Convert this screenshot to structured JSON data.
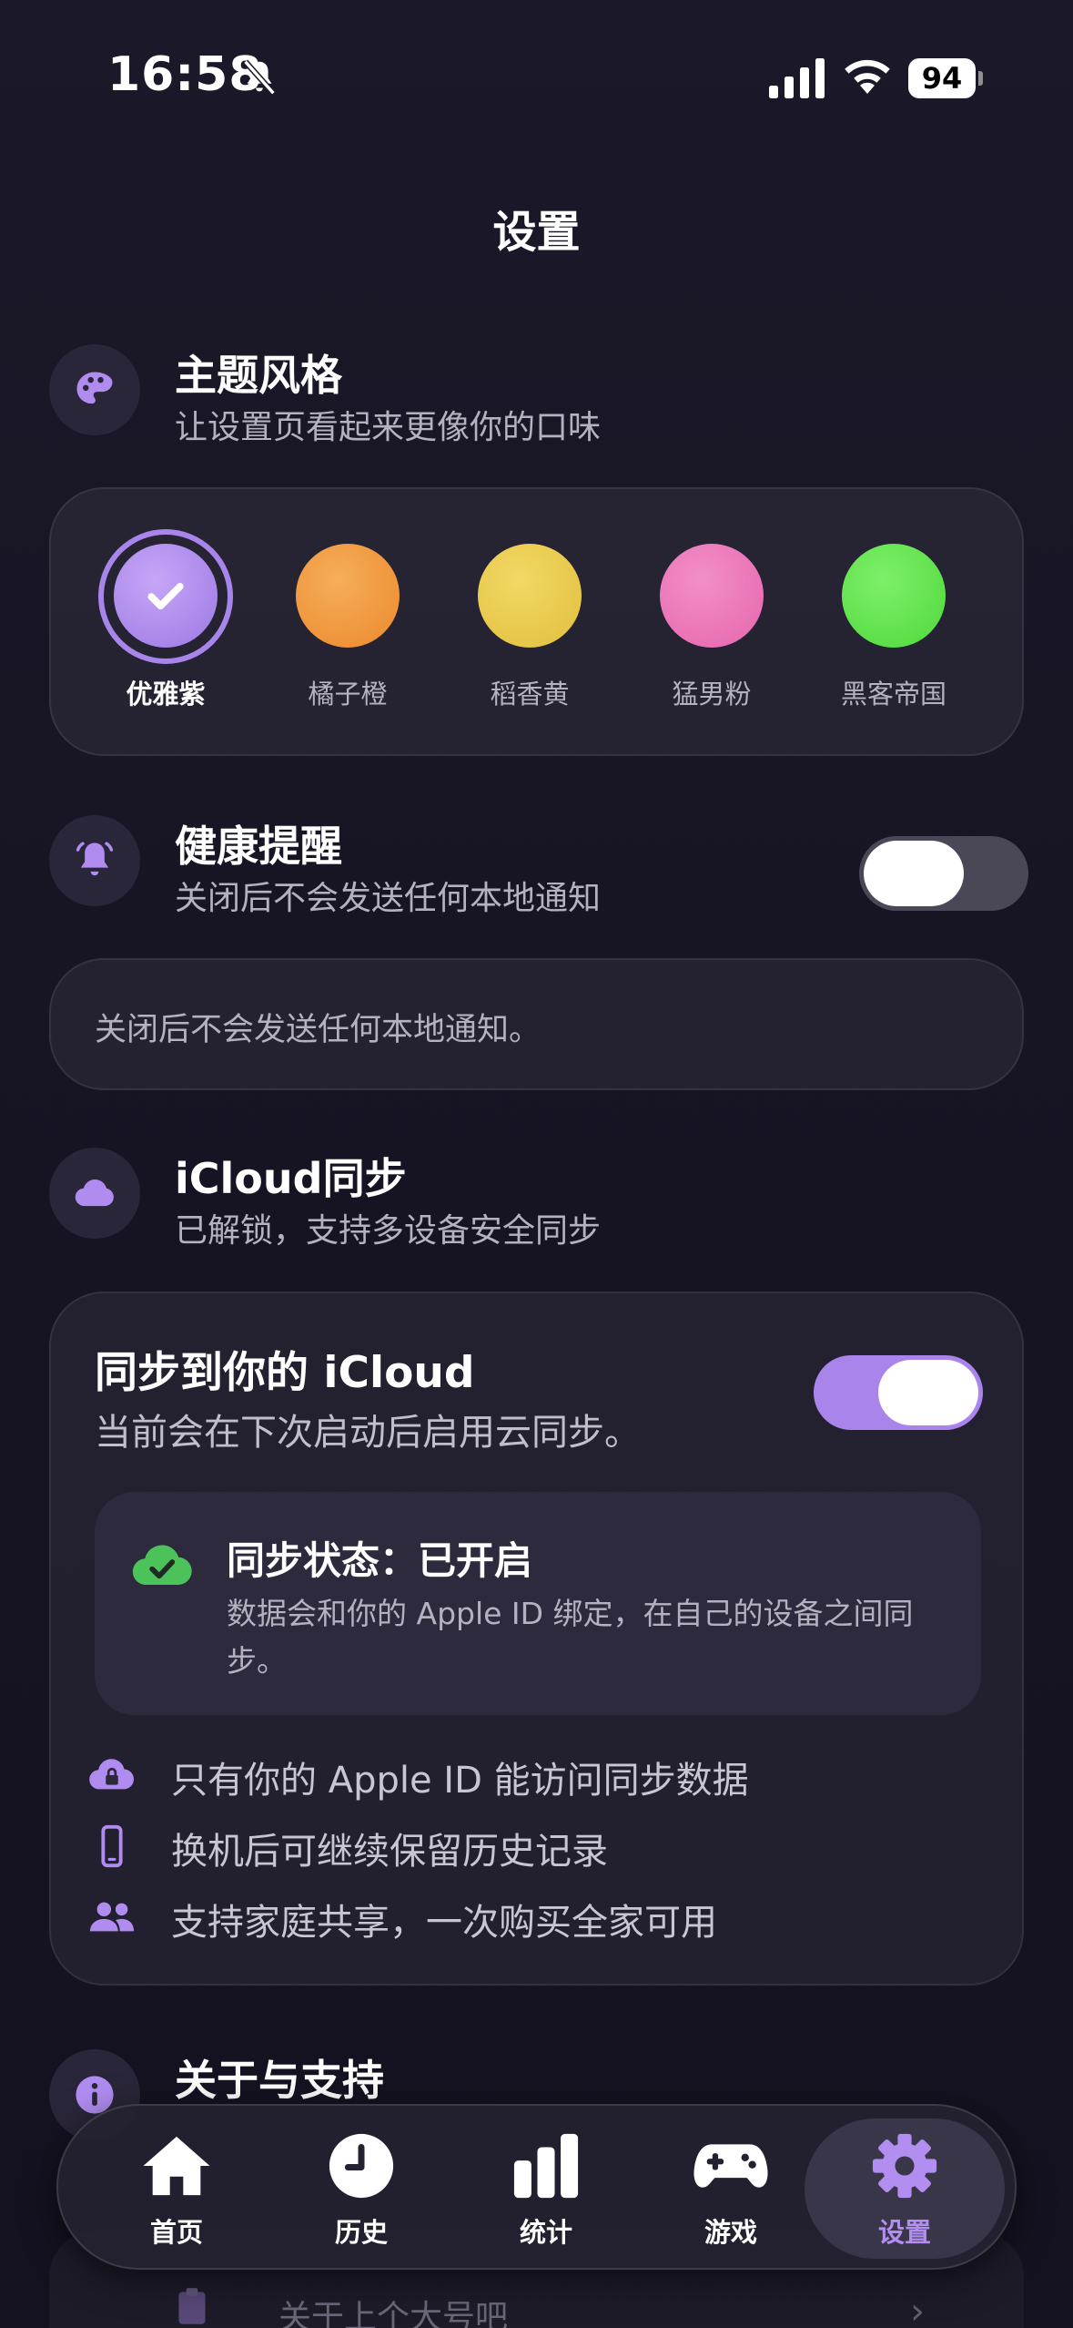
{
  "status_bar": {
    "time": "16:58",
    "battery": "94"
  },
  "page_title": "设置",
  "theme": {
    "title": "主题风格",
    "subtitle": "让设置页看起来更像你的口味",
    "swatches": [
      {
        "label": "优雅紫",
        "color": "#b08cf0",
        "selected": true
      },
      {
        "label": "橘子橙",
        "color": "#f2963a",
        "selected": false
      },
      {
        "label": "稻香黄",
        "color": "#ebcb4b",
        "selected": false
      },
      {
        "label": "猛男粉",
        "color": "#ec74b8",
        "selected": false
      },
      {
        "label": "黑客帝国",
        "color": "#5ee24a",
        "selected": false
      }
    ]
  },
  "health": {
    "title": "健康提醒",
    "subtitle": "关闭后不会发送任何本地通知",
    "toggle_on": false,
    "notice": "关闭后不会发送任何本地通知。"
  },
  "icloud": {
    "title": "iCloud同步",
    "subtitle": "已解锁，支持多设备安全同步",
    "sync_title": "同步到你的 iCloud",
    "sync_subtitle": "当前会在下次启动后启用云同步。",
    "toggle_on": true,
    "status_title": "同步状态：已开启",
    "status_desc": "数据会和你的 Apple ID 绑定，在自己的设备之间同步。",
    "features": [
      "只有你的 Apple ID 能访问同步数据",
      "换机后可继续保留历史记录",
      "支持家庭共享，一次购买全家可用"
    ]
  },
  "about": {
    "title": "关于与支持",
    "partial_row": "关于上个大号吧"
  },
  "tabs": [
    {
      "label": "首页",
      "icon": "home-icon",
      "active": false
    },
    {
      "label": "历史",
      "icon": "clock-icon",
      "active": false
    },
    {
      "label": "统计",
      "icon": "bar-chart-icon",
      "active": false
    },
    {
      "label": "游戏",
      "icon": "gamepad-icon",
      "active": false
    },
    {
      "label": "设置",
      "icon": "gear-icon",
      "active": true
    }
  ],
  "colors": {
    "accent": "#b08cf0",
    "background": "#171524",
    "toggle_off": "#4a4857"
  }
}
